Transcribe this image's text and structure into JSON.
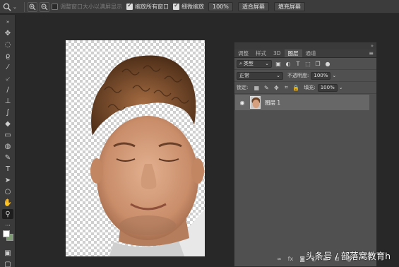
{
  "options_bar": {
    "zoom_tool_icon": "zoom-icon",
    "resize_windows_label": "调整窗口大小以满屏显示",
    "zoom_all_windows_label": "缩放所有窗口",
    "scrubby_zoom_label": "细微缩放",
    "button_100": "100%",
    "fit_screen": "适合屏幕",
    "fill_screen": "填充屏幕"
  },
  "layers_panel": {
    "tabs": [
      "调整",
      "样式",
      "3D",
      "图层",
      "通道"
    ],
    "active_tab": "图层",
    "filter_kind": "类型",
    "blend_mode": "正常",
    "opacity_label": "不透明度:",
    "opacity_value": "100%",
    "lock_label": "锁定:",
    "fill_label": "填充:",
    "fill_value": "100%",
    "layers": [
      {
        "name": "图层 1",
        "visible": true
      }
    ]
  },
  "watermark": "头条号 / 部落窝教育h",
  "colors": {
    "foreground": "#ffffff",
    "background": "#7f9b73"
  }
}
